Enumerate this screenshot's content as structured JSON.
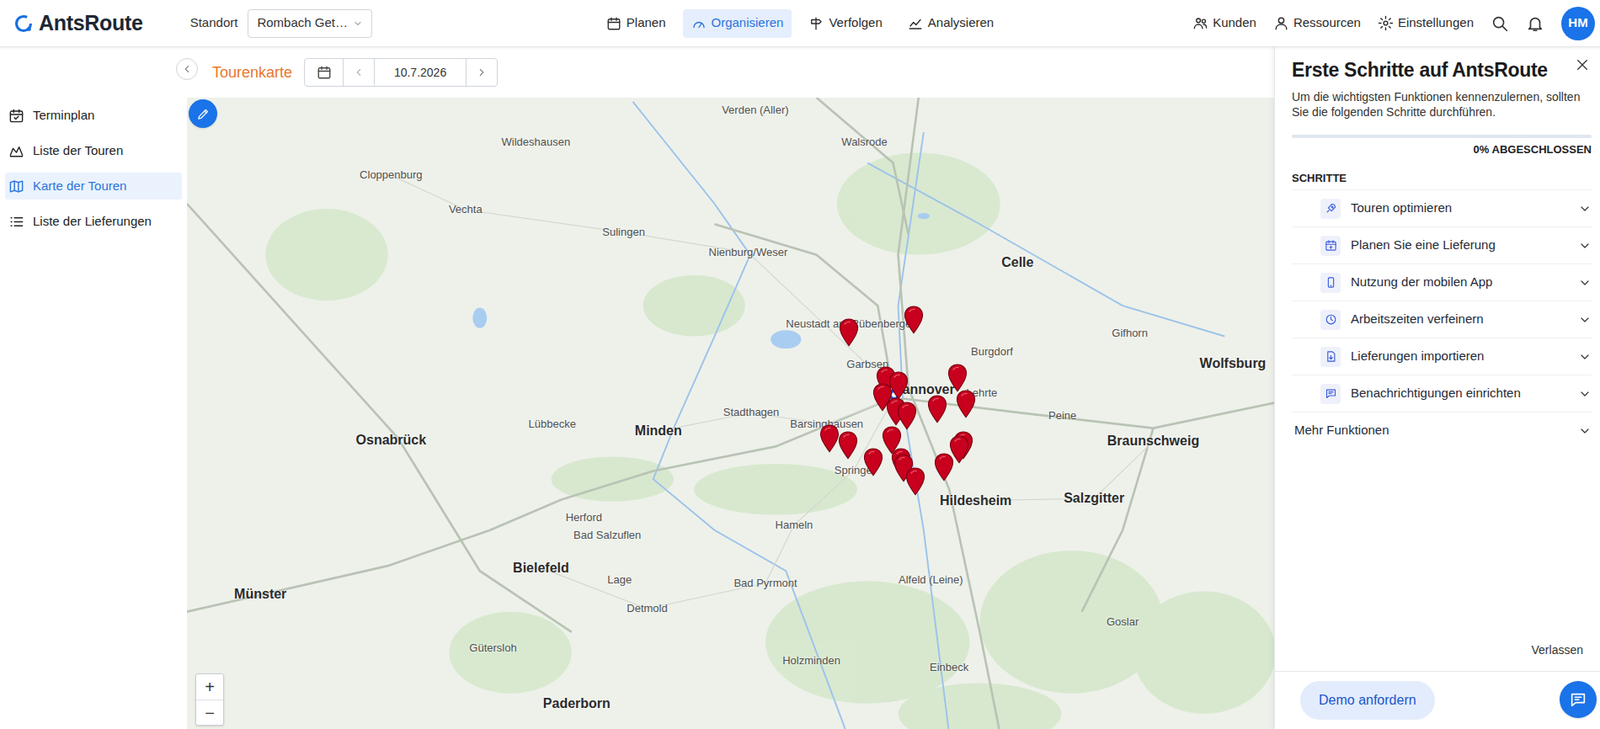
{
  "app": {
    "logo": "AntsRoute"
  },
  "location": {
    "label": "Standort",
    "value": "Rombach Get…"
  },
  "nav": [
    {
      "label": "Planen",
      "selected": false
    },
    {
      "label": "Organisieren",
      "selected": true
    },
    {
      "label": "Verfolgen",
      "selected": false
    },
    {
      "label": "Analysieren",
      "selected": false
    }
  ],
  "top_actions": [
    {
      "label": "Kunden"
    },
    {
      "label": "Ressourcen"
    },
    {
      "label": "Einstellungen"
    }
  ],
  "user": {
    "initials": "HM"
  },
  "sidebar": {
    "items": [
      {
        "label": "Terminplan",
        "selected": false
      },
      {
        "label": "Liste der Touren",
        "selected": false
      },
      {
        "label": "Karte der Touren",
        "selected": true
      },
      {
        "label": "Liste der Lieferungen",
        "selected": false
      }
    ]
  },
  "toolbar": {
    "title": "Tourenkarte",
    "date": "10.7.2026"
  },
  "map": {
    "labels": [
      {
        "text": "Verden (Aller)",
        "kind": "town"
      },
      {
        "text": "Walsrode",
        "kind": "town"
      },
      {
        "text": "Cloppenburg",
        "kind": "town"
      },
      {
        "text": "Vechta",
        "kind": "town"
      },
      {
        "text": "Nienburg/Weser",
        "kind": "town"
      },
      {
        "text": "Celle",
        "kind": "city"
      },
      {
        "text": "Neustadt am Rübenberge",
        "kind": "town"
      },
      {
        "text": "Garbsen",
        "kind": "town"
      },
      {
        "text": "Hannover",
        "kind": "city"
      },
      {
        "text": "Lehrte",
        "kind": "town"
      },
      {
        "text": "Burgdorf",
        "kind": "town"
      },
      {
        "text": "Gifhorn",
        "kind": "town"
      },
      {
        "text": "Wolfsburg",
        "kind": "city"
      },
      {
        "text": "Osnabrück",
        "kind": "city"
      },
      {
        "text": "Minden",
        "kind": "city"
      },
      {
        "text": "Stadthagen",
        "kind": "town"
      },
      {
        "text": "Barsinghausen",
        "kind": "town"
      },
      {
        "text": "Peine",
        "kind": "town"
      },
      {
        "text": "Braunschweig",
        "kind": "city"
      },
      {
        "text": "Springe",
        "kind": "town"
      },
      {
        "text": "Hildesheim",
        "kind": "city"
      },
      {
        "text": "Salzgitter",
        "kind": "city"
      },
      {
        "text": "Herford",
        "kind": "town"
      },
      {
        "text": "Bad Salzuflen",
        "kind": "town"
      },
      {
        "text": "Hameln",
        "kind": "town"
      },
      {
        "text": "Bielefeld",
        "kind": "city"
      },
      {
        "text": "Münster",
        "kind": "city"
      },
      {
        "text": "Lage",
        "kind": "town"
      },
      {
        "text": "Bad Pyrmont",
        "kind": "town"
      },
      {
        "text": "Alfeld (Leine)",
        "kind": "town"
      },
      {
        "text": "Detmold",
        "kind": "town"
      },
      {
        "text": "Gütersloh",
        "kind": "town"
      },
      {
        "text": "Paderborn",
        "kind": "city"
      },
      {
        "text": "Wildeshausen",
        "kind": "town"
      },
      {
        "text": "Sulingen",
        "kind": "town"
      },
      {
        "text": "Lübbecke",
        "kind": "town"
      },
      {
        "text": "Einbeck",
        "kind": "town"
      },
      {
        "text": "Holzminden",
        "kind": "town"
      },
      {
        "text": "Goslar",
        "kind": "town"
      }
    ],
    "pins": [
      {
        "kind": "depot"
      },
      {
        "kind": "delivery"
      },
      {
        "kind": "delivery"
      },
      {
        "kind": "delivery"
      },
      {
        "kind": "delivery"
      },
      {
        "kind": "delivery"
      },
      {
        "kind": "delivery"
      },
      {
        "kind": "delivery"
      },
      {
        "kind": "delivery"
      },
      {
        "kind": "delivery"
      },
      {
        "kind": "delivery"
      },
      {
        "kind": "delivery"
      },
      {
        "kind": "delivery"
      },
      {
        "kind": "delivery"
      },
      {
        "kind": "delivery"
      },
      {
        "kind": "delivery"
      },
      {
        "kind": "delivery"
      },
      {
        "kind": "delivery"
      },
      {
        "kind": "delivery"
      },
      {
        "kind": "delivery"
      },
      {
        "kind": "delivery"
      }
    ],
    "zoom": [
      "+",
      "−"
    ]
  },
  "onboarding": {
    "title": "Erste Schritte auf AntsRoute",
    "description": "Um die wichtigsten Funktionen kennenzulernen, sollten Sie die folgenden Schritte durchführen.",
    "progress": {
      "level": 0,
      "reading": "0% ABGESCHLOSSEN"
    },
    "section": "SCHRITTE",
    "steps": [
      {
        "label": "Touren optimieren",
        "expanded": false
      },
      {
        "label": "Planen Sie eine Lieferung",
        "expanded": false
      },
      {
        "label": "Nutzung der mobilen App",
        "expanded": false
      },
      {
        "label": "Arbeitszeiten verfeinern",
        "expanded": false
      },
      {
        "label": "Lieferungen importieren",
        "expanded": false
      },
      {
        "label": "Benachrichtigungen einrichten",
        "expanded": false
      }
    ],
    "more": {
      "label": "Mehr Funktionen",
      "expanded": false
    },
    "leave": "Verlassen",
    "demo": "Demo anfordern"
  }
}
